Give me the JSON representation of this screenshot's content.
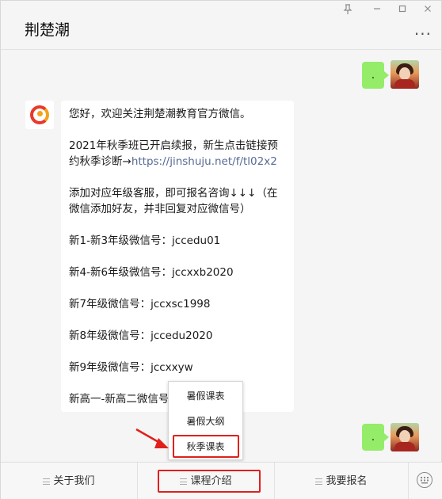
{
  "window": {
    "title": "荆楚潮",
    "controls": [
      "pin-icon",
      "minimize-icon",
      "maximize-icon",
      "close-icon"
    ],
    "more_label": "···"
  },
  "messages": {
    "sent_1": ".",
    "sent_2": ".",
    "received": [
      "您好，欢迎关注荆楚潮教育官方微信。",
      "2021年秋季班已开启续报，新生点击链接预约秋季诊断→",
      "https://jinshuju.net/f/tl02x2",
      "添加对应年级客服，即可报名咨询↓↓↓（在微信添加好友，并非回复对应微信号）",
      "新1-新3年级微信号：jccedu01",
      "新4-新6年级微信号：jccxxb2020",
      "新7年级微信号：jccxsc1998",
      "新8年级微信号：jccedu2020",
      "新9年级微信号：jccxxyw",
      "新高一-新高二微信号"
    ]
  },
  "submenu": {
    "items": [
      "暑假课表",
      "暑假大纲",
      "秋季课表"
    ],
    "selected_index": 2
  },
  "menubar": {
    "items": [
      "关于我们",
      "课程介绍",
      "我要报名"
    ],
    "selected_index": 1,
    "keyboard_icon": "keyboard-icon"
  },
  "colors": {
    "sent_bubble": "#95ec69",
    "link": "#576b95",
    "highlight": "#e0201c",
    "brand_red": "#e8392a",
    "brand_orange": "#f4a11b"
  }
}
